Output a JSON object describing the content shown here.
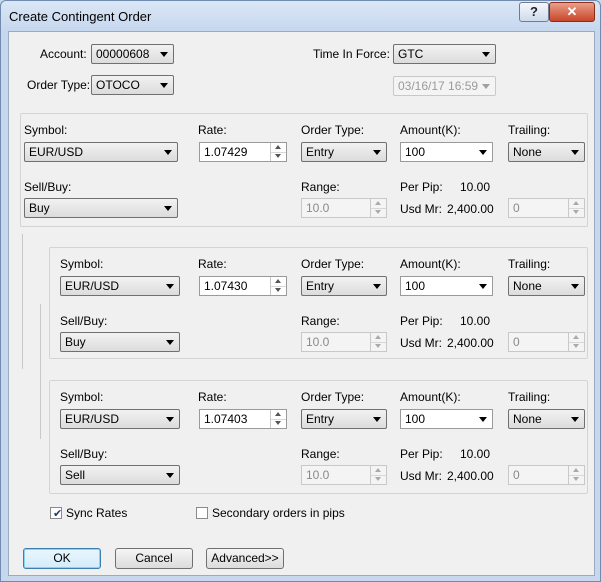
{
  "window": {
    "title": "Create Contingent Order",
    "help_label": "?",
    "close_label": "✕"
  },
  "header": {
    "account_label": "Account:",
    "account_value": "00000608",
    "order_type_label": "Order Type:",
    "order_type_value": "OTOCO",
    "tif_label": "Time In Force:",
    "tif_value": "GTC",
    "date_value": "03/16/17 16:59"
  },
  "orders": [
    {
      "symbol_label": "Symbol:",
      "symbol": "EUR/USD",
      "rate_label": "Rate:",
      "rate": "1.07429",
      "order_type_label": "Order Type:",
      "order_type": "Entry",
      "amount_label": "Amount(K):",
      "amount": "100",
      "trailing_label": "Trailing:",
      "trailing": "None",
      "sellbuy_label": "Sell/Buy:",
      "sellbuy": "Buy",
      "range_label": "Range:",
      "range": "10.0",
      "perpip_label": "Per Pip:",
      "perpip": "10.00",
      "usdmr_label": "Usd Mr:",
      "usdmr": "2,400.00",
      "trailing_value": "0"
    },
    {
      "symbol_label": "Symbol:",
      "symbol": "EUR/USD",
      "rate_label": "Rate:",
      "rate": "1.07430",
      "order_type_label": "Order Type:",
      "order_type": "Entry",
      "amount_label": "Amount(K):",
      "amount": "100",
      "trailing_label": "Trailing:",
      "trailing": "None",
      "sellbuy_label": "Sell/Buy:",
      "sellbuy": "Buy",
      "range_label": "Range:",
      "range": "10.0",
      "perpip_label": "Per Pip:",
      "perpip": "10.00",
      "usdmr_label": "Usd Mr:",
      "usdmr": "2,400.00",
      "trailing_value": "0"
    },
    {
      "symbol_label": "Symbol:",
      "symbol": "EUR/USD",
      "rate_label": "Rate:",
      "rate": "1.07403",
      "order_type_label": "Order Type:",
      "order_type": "Entry",
      "amount_label": "Amount(K):",
      "amount": "100",
      "trailing_label": "Trailing:",
      "trailing": "None",
      "sellbuy_label": "Sell/Buy:",
      "sellbuy": "Sell",
      "range_label": "Range:",
      "range": "10.0",
      "perpip_label": "Per Pip:",
      "perpip": "10.00",
      "usdmr_label": "Usd Mr:",
      "usdmr": "2,400.00",
      "trailing_value": "0"
    }
  ],
  "options": {
    "sync_rates_label": "Sync Rates",
    "sync_rates_checked": true,
    "secondary_pips_label": "Secondary orders in pips",
    "secondary_pips_checked": false
  },
  "buttons": {
    "ok": "OK",
    "cancel": "Cancel",
    "advanced": "Advanced>>"
  }
}
